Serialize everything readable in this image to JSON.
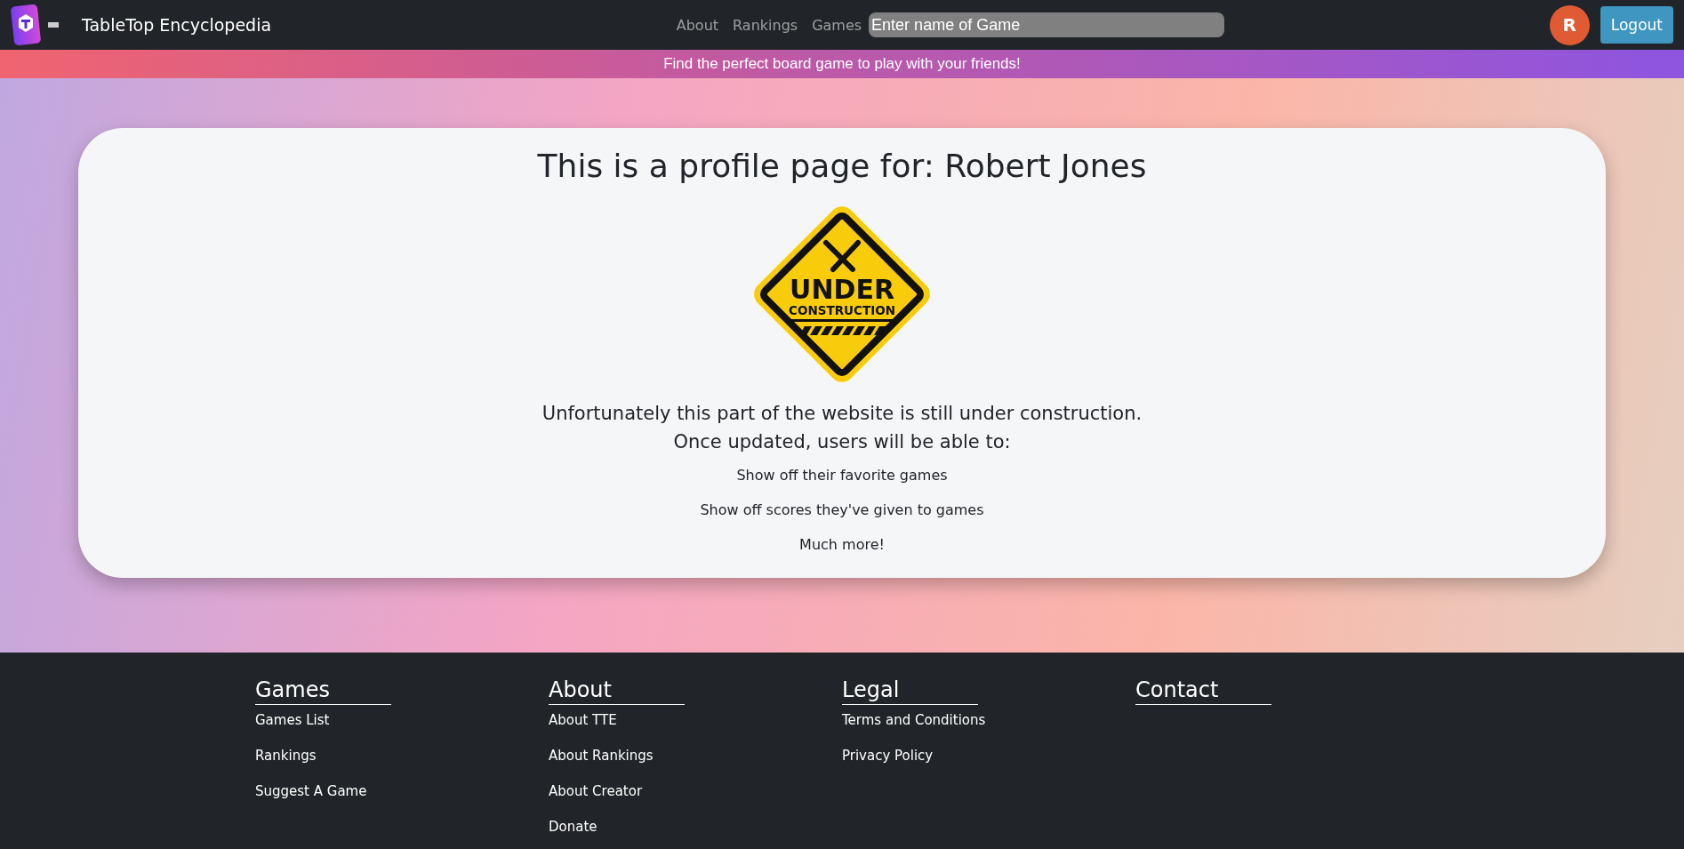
{
  "navbar": {
    "brand": "TableTop Encyclopedia",
    "links": [
      "About",
      "Rankings",
      "Games"
    ],
    "search": {
      "placeholder": "Enter name of Game"
    },
    "avatar": "R",
    "logout": "Logout"
  },
  "banner": "Find the perfect board game to play with your friends!",
  "profile": {
    "title": "This is a profile page for: Robert Jones",
    "sign": {
      "line_1": "UNDER",
      "line_2": "CONSTRUCTION"
    },
    "message": "Unfortunately this part of the website is still under construction.",
    "subtitle": "Once updated, users will be able to:",
    "features": [
      "Show off their favorite games",
      "Show off scores they've given to games",
      "Much more!"
    ]
  },
  "footer": [
    {
      "heading": "Games",
      "links": [
        "Games List",
        "Rankings",
        "Suggest A Game"
      ]
    },
    {
      "heading": "About",
      "links": [
        "About TTE",
        "About Rankings",
        "About Creator",
        "Donate"
      ]
    },
    {
      "heading": "Legal",
      "links": [
        "Terms and Conditions",
        "Privacy Policy"
      ]
    },
    {
      "heading": "Contact"
    }
  ]
}
